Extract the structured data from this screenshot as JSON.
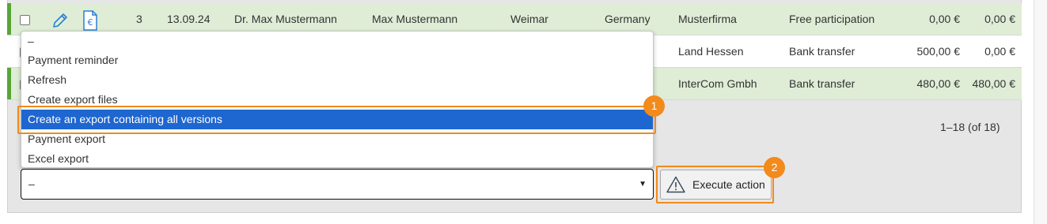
{
  "rows": [
    {
      "number": "3",
      "date": "13.09.24",
      "name": "Dr. Max Mustermann",
      "contact": "Max Mustermann",
      "city": "Weimar",
      "country": "Germany",
      "company": "Musterfirma",
      "payment_method": "Free participation",
      "amount": "0,00 €",
      "paid": "0,00 €"
    },
    {
      "company": "Land Hessen",
      "payment_method": "Bank transfer",
      "amount": "500,00 €",
      "paid": "0,00 €"
    },
    {
      "company": "InterCom Gmbh",
      "payment_method": "Bank transfer",
      "amount": "480,00 €",
      "paid": "480,00 €"
    }
  ],
  "pagination": {
    "text": "1–18 (of 18)"
  },
  "dropdown": {
    "options": [
      "–",
      "Payment reminder",
      "Refresh",
      "Create export files",
      "Create an export containing all versions",
      "Payment export",
      "Excel export"
    ],
    "highlighted_index": 4
  },
  "action_select": {
    "value": "–"
  },
  "execute_button": {
    "label": "Execute action",
    "icon": "warning-icon"
  },
  "callouts": {
    "first": "1",
    "second": "2"
  },
  "colors": {
    "row_green": "#dfedd6",
    "status_bar": "#59a43a",
    "highlight": "#1e66d0",
    "callout": "#f28a1c"
  }
}
